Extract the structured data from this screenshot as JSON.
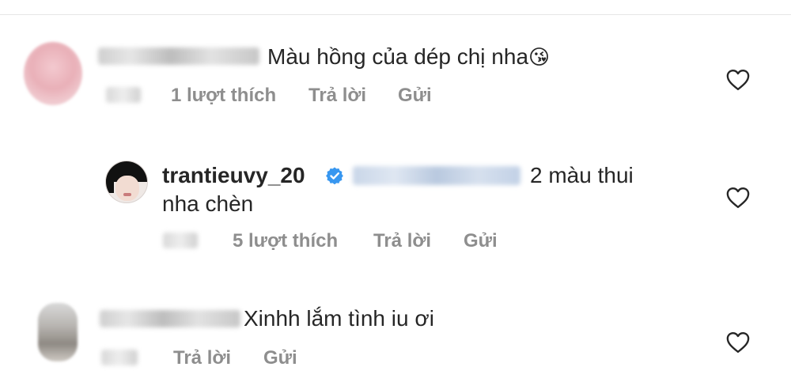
{
  "comments": [
    {
      "text": "Màu hồng của dép chị nha",
      "emoji": "😘",
      "likes": "1 lượt thích",
      "reply": "Trả lời",
      "send": "Gửi"
    },
    {
      "username": "trantieuvy_20",
      "verified": true,
      "text_line1": "2 màu thui",
      "text_line2": "nha chèn",
      "likes": "5 lượt thích",
      "reply": "Trả lời",
      "send": "Gửi"
    },
    {
      "text": "Xinhh lắm tình iu ơi",
      "reply": "Trả lời",
      "send": "Gửi"
    }
  ],
  "colors": {
    "verified": "#3897f0",
    "meta": "#8e8e8e",
    "text": "#262626"
  },
  "icons": {
    "like": "heart-outline-icon",
    "verified": "verified-badge-icon"
  }
}
